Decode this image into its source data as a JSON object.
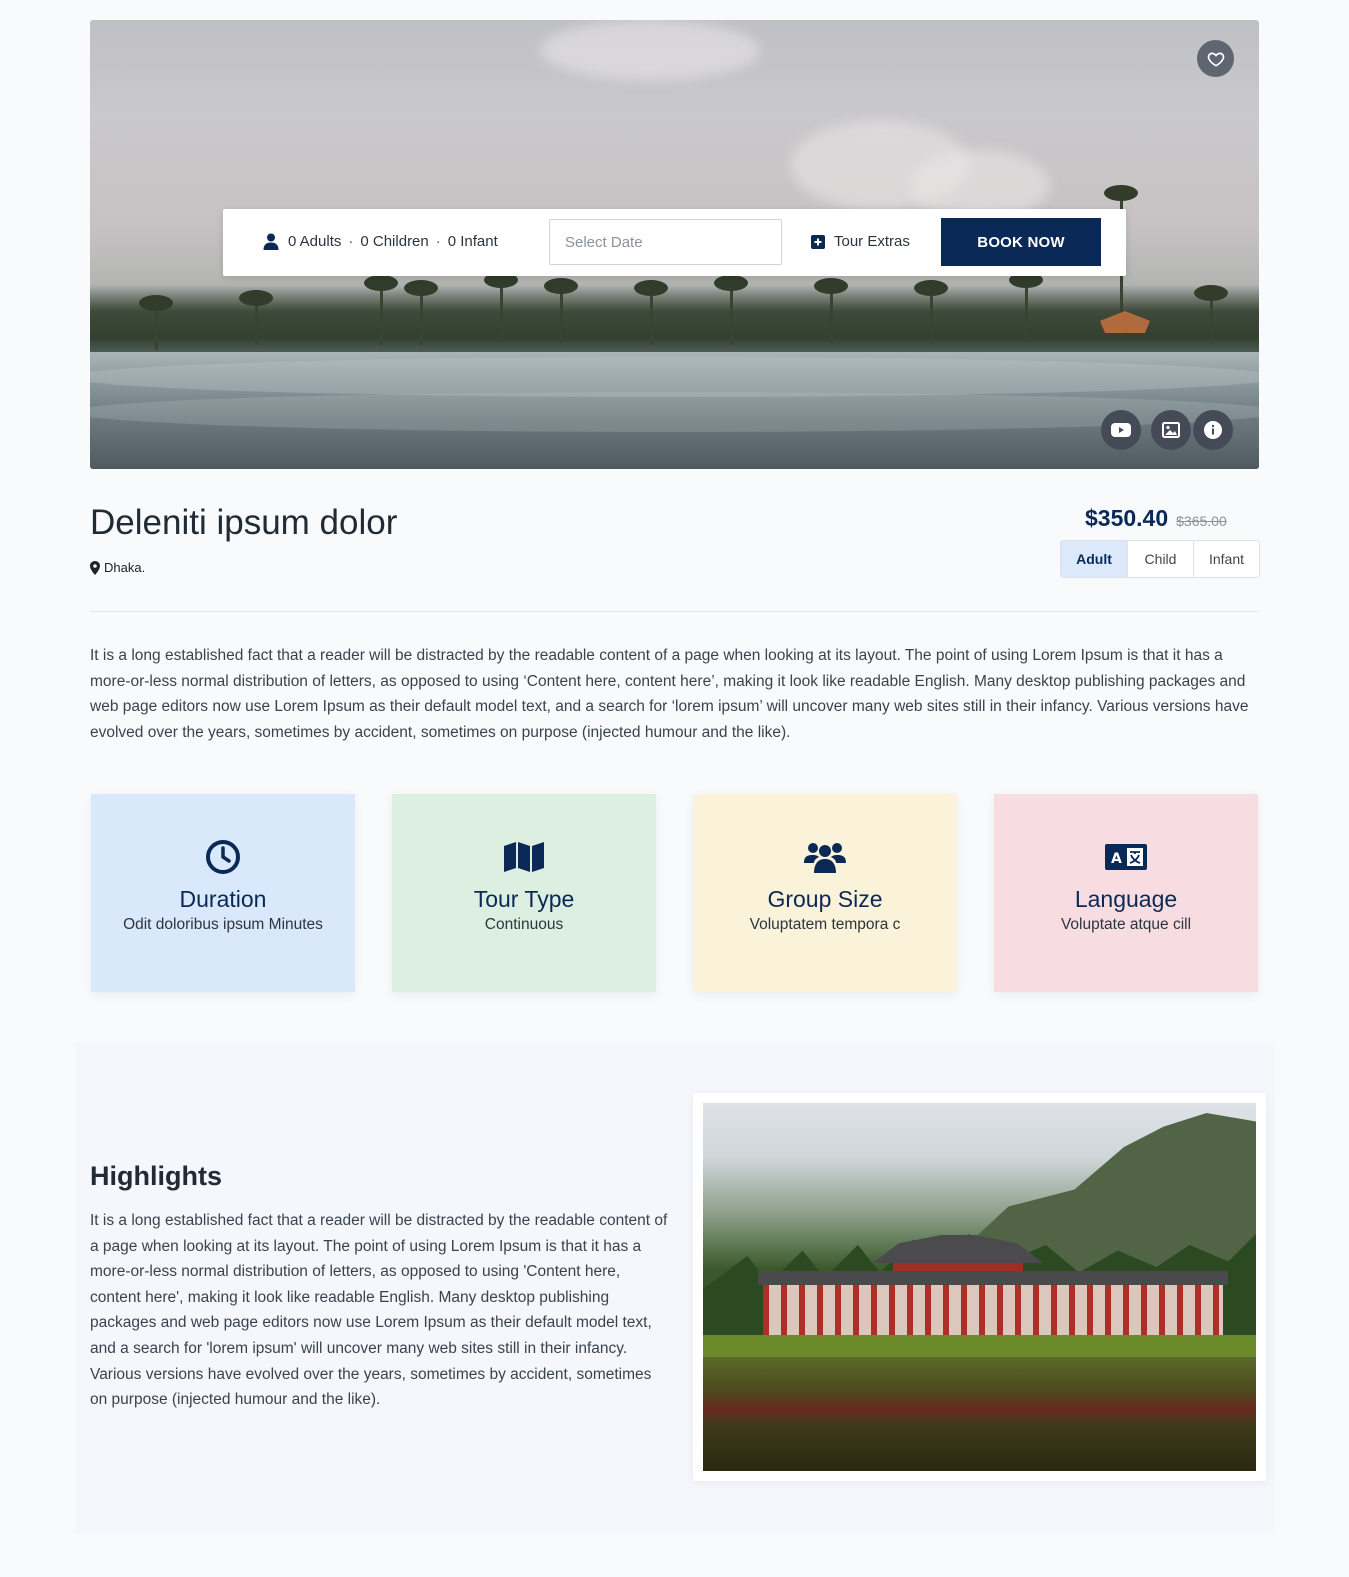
{
  "booking": {
    "guests": {
      "adults": "0 Adults",
      "children": "0 Children",
      "infant": "0 Infant",
      "separator": "·"
    },
    "date_placeholder": "Select Date",
    "extras_label": "Tour Extras",
    "book_label": "BOOK NOW"
  },
  "tour": {
    "title": "Deleniti ipsum dolor",
    "location": "Dhaka.",
    "price_now": "$350.40",
    "price_old": "$365.00",
    "price_tabs": [
      {
        "label": "Adult",
        "active": true
      },
      {
        "label": "Child",
        "active": false
      },
      {
        "label": "Infant",
        "active": false
      }
    ],
    "description": "It is a long established fact that a reader will be distracted by the readable content of a page when looking at its layout. The point of using Lorem Ipsum is that it has a more-or-less normal distribution of letters, as opposed to using ‘Content here, content here’, making it look like readable English. Many desktop publishing packages and web page editors now use Lorem Ipsum as their default model text, and a search for ‘lorem ipsum’ will uncover many web sites still in their infancy. Various versions have evolved over the years, sometimes by accident, sometimes on purpose (injected humour and the like)."
  },
  "features": [
    {
      "icon": "clock-icon",
      "title": "Duration",
      "value": "Odit doloribus ipsum Minutes",
      "bg": "#d9e8fa"
    },
    {
      "icon": "map-icon",
      "title": "Tour Type",
      "value": "Continuous",
      "bg": "#dcefe0"
    },
    {
      "icon": "users-icon",
      "title": "Group Size",
      "value": "Voluptatem tempora c",
      "bg": "#fbf3d9"
    },
    {
      "icon": "language-icon",
      "title": "Language",
      "value": "Voluptate atque cill",
      "bg": "#f7dde2"
    }
  ],
  "highlights": {
    "title": "Highlights",
    "text": "It is a long established fact that a reader will be distracted by the readable content of a page when looking at its layout. The point of using Lorem Ipsum is that it has a more-or-less normal distribution of letters, as opposed to using 'Content here, content here', making it look like readable English. Many desktop publishing packages and web page editors now use Lorem Ipsum as their default model text, and a search for 'lorem ipsum' will uncover many web sites still in their infancy. Various versions have evolved over the years, sometimes by accident, sometimes on purpose (injected humour and the like)."
  },
  "colors": {
    "primary": "#0b2956",
    "active_tab": "#dbe9fb"
  }
}
